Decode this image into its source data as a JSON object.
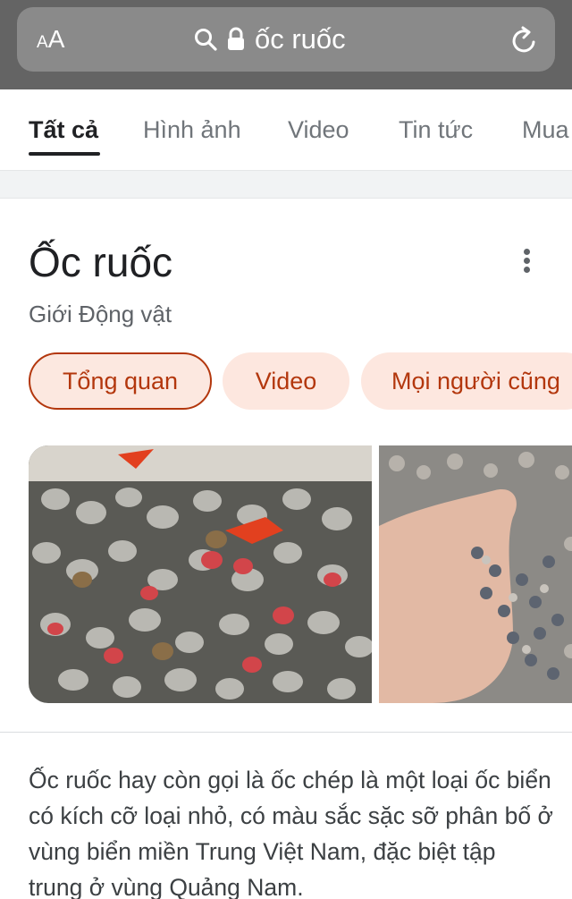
{
  "browser": {
    "text_size_label_small": "A",
    "text_size_label_large": "A",
    "url_text": "ốc ruốc"
  },
  "tabs": [
    {
      "label": "Tất cả",
      "active": true
    },
    {
      "label": "Hình ảnh",
      "active": false
    },
    {
      "label": "Video",
      "active": false
    },
    {
      "label": "Tin tức",
      "active": false
    },
    {
      "label": "Mua",
      "active": false
    }
  ],
  "knowledge_panel": {
    "title": "Ốc ruốc",
    "subtitle": "Giới Động vật",
    "chips": [
      {
        "label": "Tổng quan",
        "active": true
      },
      {
        "label": "Video",
        "active": false
      },
      {
        "label": "Mọi người cũng",
        "active": false
      }
    ],
    "description": "Ốc ruốc hay còn gọi là ốc chép là một loại ốc biển có kích cỡ loại nhỏ, có màu sắc sặc sỡ phân bố ở vùng biển miền Trung Việt Nam, đặc biệt tập trung ở vùng Quảng Nam."
  },
  "colors": {
    "browser_chrome": "#646464",
    "address_bar": "#8a8a8a",
    "chip_background": "#fde7df",
    "chip_text": "#b3370d",
    "active_tab": "#202124",
    "inactive_tab": "#70757a"
  },
  "icons": [
    "search-icon",
    "lock-icon",
    "reload-icon",
    "more-vert-icon"
  ]
}
